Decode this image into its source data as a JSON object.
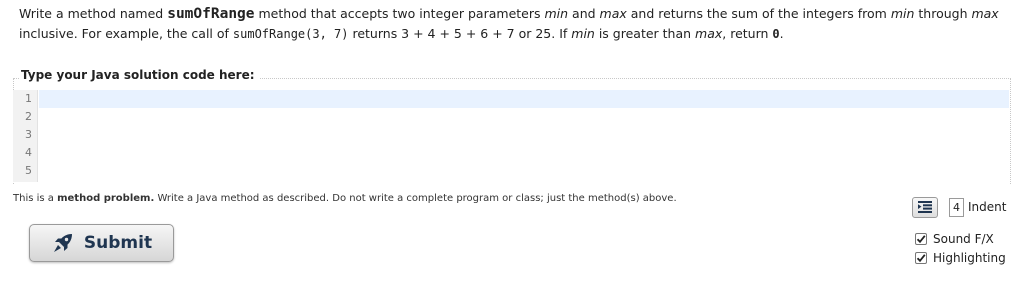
{
  "problem": {
    "p1": "Write a method named ",
    "method_name": "sumOfRange",
    "p2": " method that accepts two integer parameters ",
    "param_min": "min",
    "p3": " and ",
    "param_max": "max",
    "p4": " and returns the sum of the integers from ",
    "min2": "min",
    "p5": " through ",
    "max2": "max",
    "p6": " inclusive. For example, the call of ",
    "example_call": "sumOfRange(3, 7)",
    "p7": " returns 3 + 4 + 5 + 6 + 7 or 25. If ",
    "min3": "min",
    "p8": " is greater than ",
    "max3": "max",
    "p9": ", return ",
    "zero": "0",
    "p10": "."
  },
  "editor": {
    "legend": "Type your Java solution code here:",
    "line_numbers": [
      "1",
      "2",
      "3",
      "4",
      "5"
    ],
    "code": ""
  },
  "note": {
    "prefix": "This is a ",
    "bold": "method problem.",
    "rest": " Write a Java method as described. Do not write a complete program or class; just the method(s) above."
  },
  "submit": {
    "label": "Submit",
    "icon": "rocket-icon"
  },
  "indent": {
    "value": "4",
    "label": "Indent",
    "icon": "indent-icon"
  },
  "options": [
    {
      "label": "Sound F/X",
      "checked": true
    },
    {
      "label": "Highlighting",
      "checked": true
    }
  ]
}
